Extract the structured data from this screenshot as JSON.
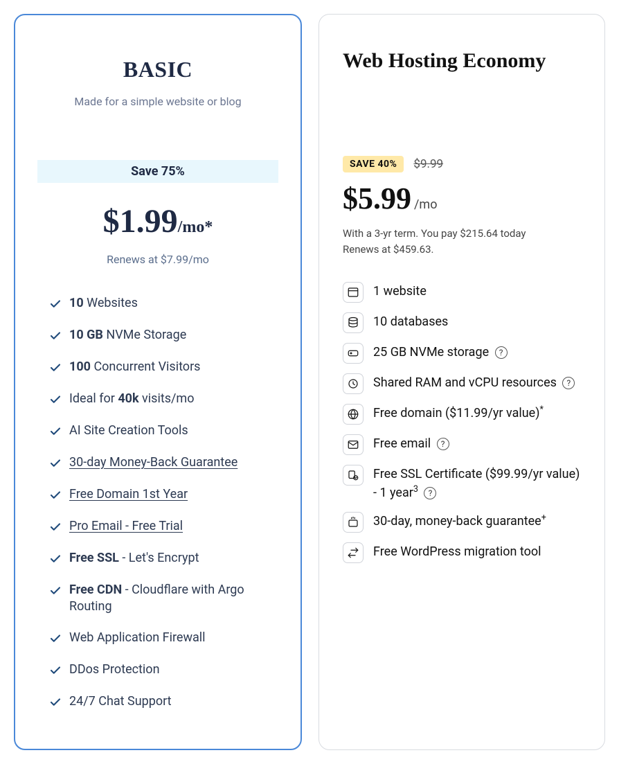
{
  "basic": {
    "title": "BASIC",
    "subtitle": "Made for a simple website or blog",
    "save_band": "Save 75%",
    "price": "$1.99",
    "price_suffix": "/mo*",
    "renews": "Renews at $7.99/mo",
    "features": {
      "f1_bold": "10",
      "f1_rest": " Websites",
      "f2_bold": "10 GB",
      "f2_rest": " NVMe Storage",
      "f3_bold": "100",
      "f3_rest": " Concurrent Visitors",
      "f4_pre": "Ideal for ",
      "f4_bold": "40k",
      "f4_rest": " visits/mo",
      "f5": "AI Site Creation Tools",
      "f6": "30-day Money-Back Guarantee",
      "f7": "Free Domain 1st Year",
      "f8": "Pro Email - Free Trial",
      "f9_bold": "Free SSL",
      "f9_rest": " - Let's Encrypt",
      "f10_bold": "Free CDN",
      "f10_rest": " - Cloudflare with Argo Routing",
      "f11": "Web Application Firewall",
      "f12": "DDos Protection",
      "f13": "24/7 Chat Support"
    }
  },
  "economy": {
    "title": "Web Hosting Economy",
    "save_pill": "SAVE 40%",
    "original_price": "$9.99",
    "price": "$5.99",
    "price_suffix": "/mo",
    "fineprint_line1": "With a 3-yr term. You pay $215.64 today",
    "fineprint_line2": "Renews at $459.63.",
    "features": {
      "e1": "1 website",
      "e2": "10 databases",
      "e3": "25 GB NVMe storage",
      "e4": "Shared RAM and vCPU resources",
      "e5_pre": "Free domain ($11.99/yr value)",
      "e6": "Free email",
      "e7_pre": "Free SSL Certificate ($99.99/yr value) - 1 year",
      "e8_pre": "30-day, money-back guarantee",
      "e9": "Free WordPress migration tool"
    }
  }
}
